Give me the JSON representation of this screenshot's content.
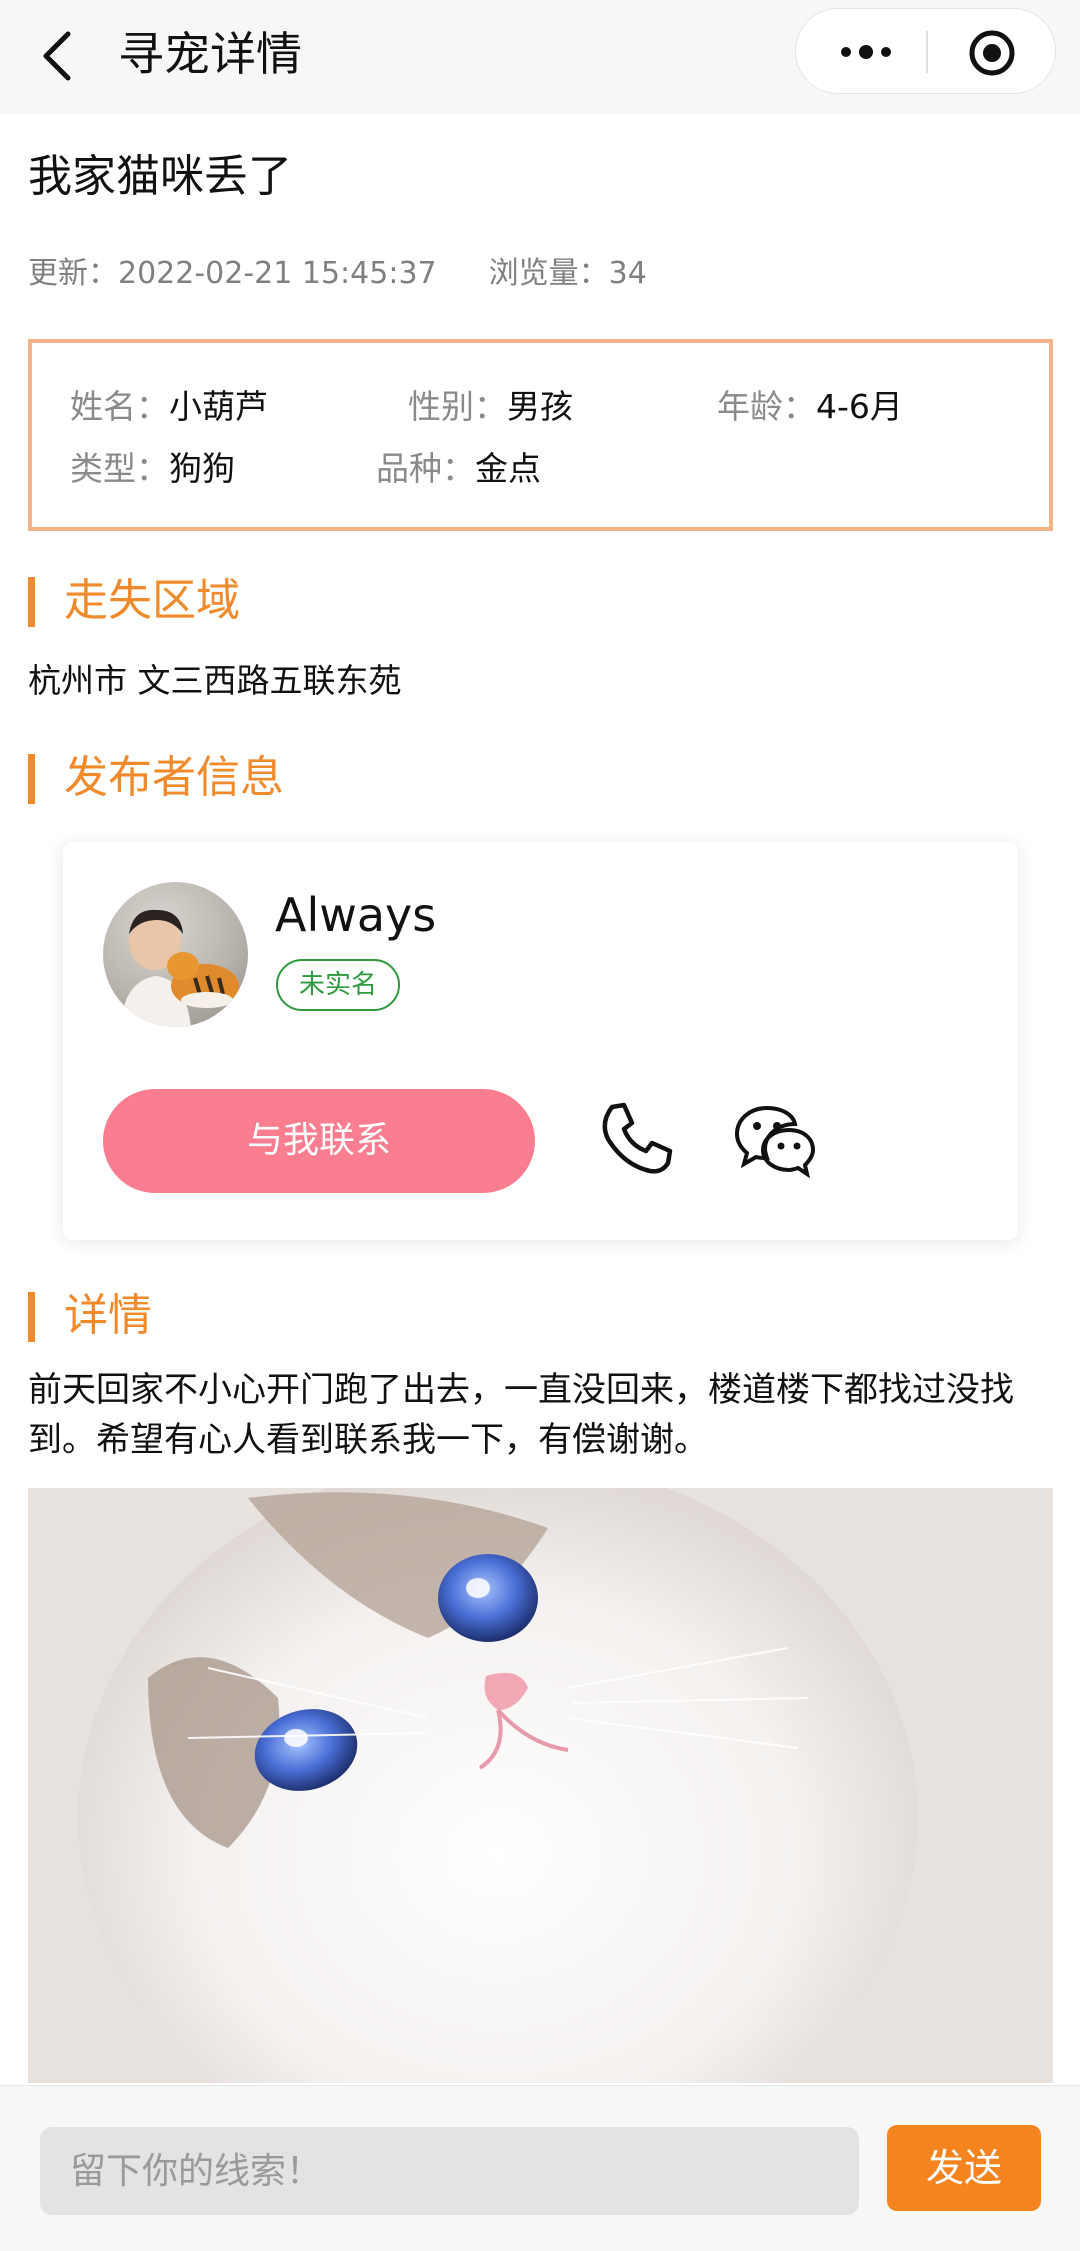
{
  "nav": {
    "title": "寻宠详情",
    "back_icon": "chevron-left-icon",
    "more_icon": "more-dots-icon",
    "target_icon": "target-icon"
  },
  "post": {
    "title": "我家猫咪丢了",
    "updated_label": "更新：",
    "updated_value": "2022-02-21 15:45:37",
    "views_label": "浏览量：",
    "views_value": "34"
  },
  "pet_info": {
    "name_label": "姓名：",
    "name_value": "小葫芦",
    "gender_label": "性别：",
    "gender_value": "男孩",
    "age_label": "年龄：",
    "age_value": "4-6月",
    "type_label": "类型：",
    "type_value": "狗狗",
    "breed_label": "品种：",
    "breed_value": "金点"
  },
  "lost_area": {
    "heading": "走失区域",
    "text": "杭州市 文三西路五联东苑"
  },
  "publisher": {
    "heading": "发布者信息",
    "username": "Always",
    "badge": "未实名",
    "contact_button": "与我联系",
    "phone_icon": "phone-icon",
    "wechat_icon": "wechat-icon"
  },
  "detail": {
    "heading": "详情",
    "text": "前天回家不小心开门跑了出去，一直没回来，楼道楼下都找过没找到。希望有心人看到联系我一下，有偿谢谢。"
  },
  "comment": {
    "placeholder": "留下你的线索！",
    "send_label": "发送"
  },
  "colors": {
    "accent": "#f08a2a",
    "info_border": "#f5b488",
    "contact_button": "#fb7d90",
    "badge_green": "#2e9a3c",
    "send_button": "#f5841f"
  }
}
